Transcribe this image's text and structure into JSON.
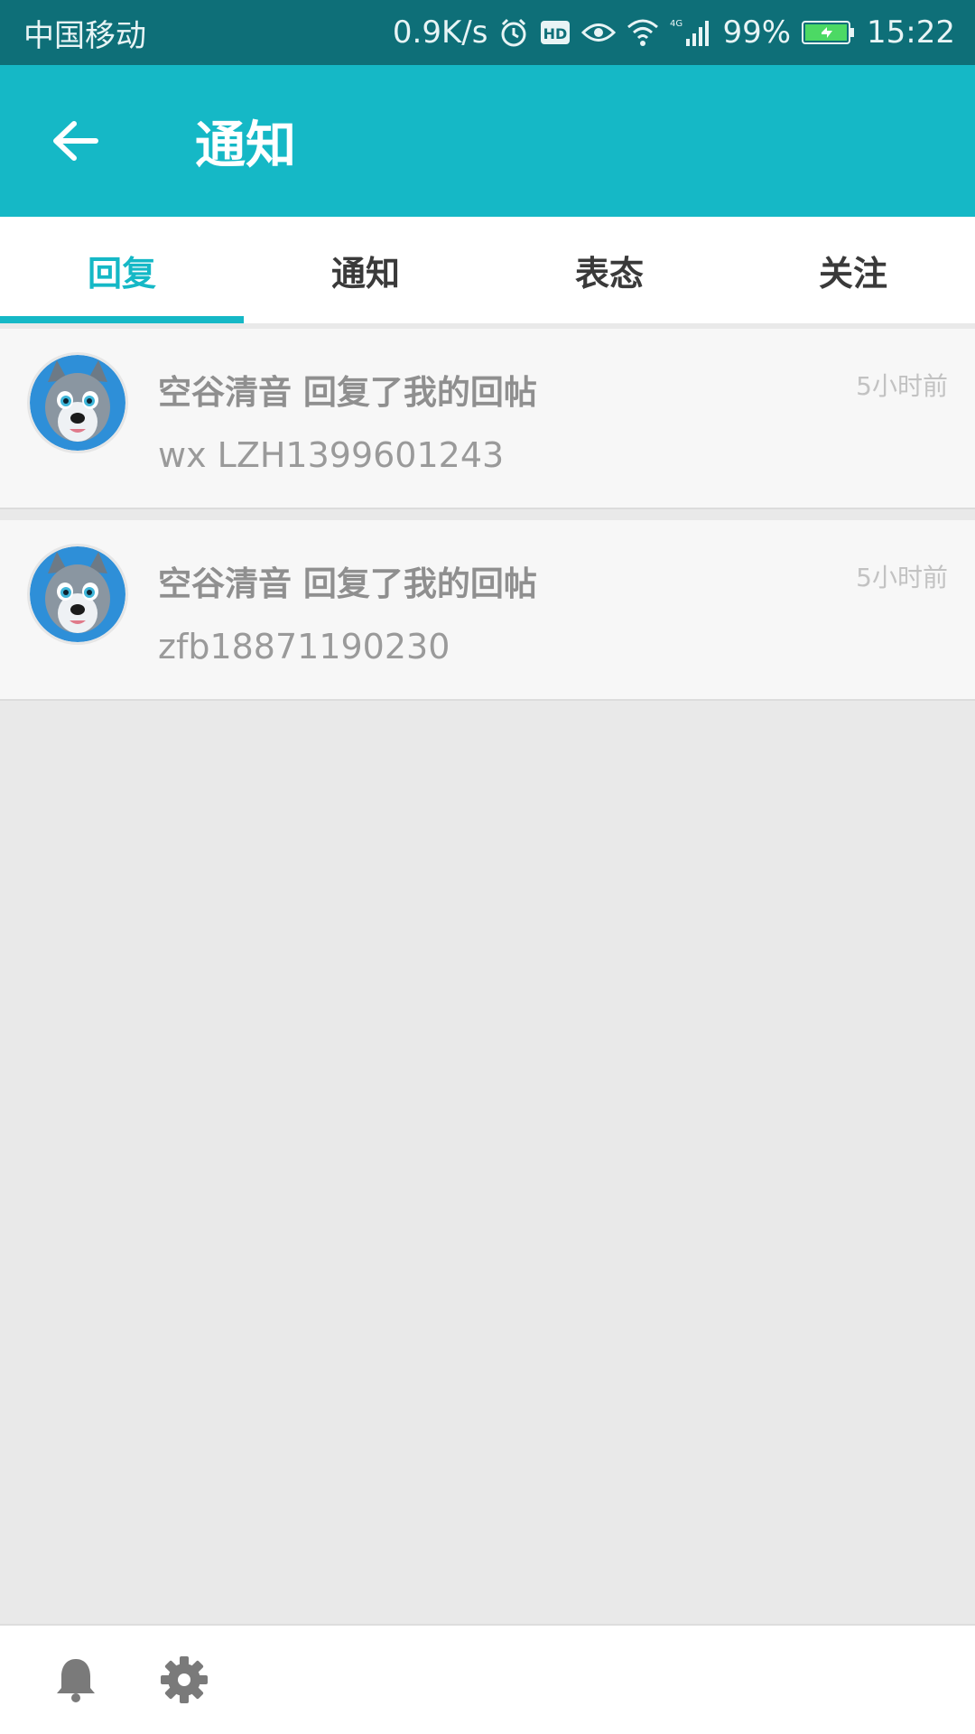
{
  "status_bar": {
    "carrier": "中国移动",
    "net_speed": "0.9K/s",
    "network_type": "4G",
    "battery": "99%",
    "time": "15:22",
    "icons": [
      "alarm-icon",
      "hd-icon",
      "eye-icon",
      "wifi-icon",
      "signal-icon",
      "battery-icon"
    ]
  },
  "app_bar": {
    "title": "通知",
    "back_icon": "arrow-left-icon",
    "color": "#15b8c6"
  },
  "tabs": [
    {
      "label": "回复",
      "active": true
    },
    {
      "label": "通知",
      "active": false
    },
    {
      "label": "表态",
      "active": false
    },
    {
      "label": "关注",
      "active": false
    }
  ],
  "notifications": [
    {
      "title": "空谷清音 回复了我的回帖",
      "time": "5小时前",
      "body": "wx LZH1399601243",
      "avatar": "wolf-avatar"
    },
    {
      "title": "空谷清音 回复了我的回帖",
      "time": "5小时前",
      "body": "zfb18871190230",
      "avatar": "wolf-avatar"
    }
  ],
  "bottom_bar": {
    "icons": [
      "bell-icon",
      "gear-icon"
    ]
  }
}
